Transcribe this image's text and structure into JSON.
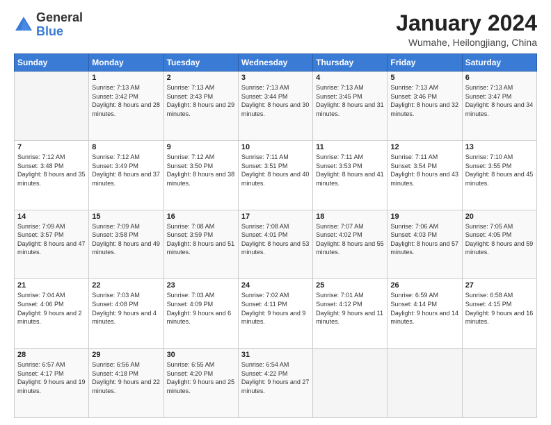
{
  "header": {
    "logo": {
      "general": "General",
      "blue": "Blue"
    },
    "title": "January 2024",
    "location": "Wumahe, Heilongjiang, China"
  },
  "weekdays": [
    "Sunday",
    "Monday",
    "Tuesday",
    "Wednesday",
    "Thursday",
    "Friday",
    "Saturday"
  ],
  "weeks": [
    [
      {
        "day": "",
        "sunrise": "",
        "sunset": "",
        "daylight": ""
      },
      {
        "day": "1",
        "sunrise": "Sunrise: 7:13 AM",
        "sunset": "Sunset: 3:42 PM",
        "daylight": "Daylight: 8 hours and 28 minutes."
      },
      {
        "day": "2",
        "sunrise": "Sunrise: 7:13 AM",
        "sunset": "Sunset: 3:43 PM",
        "daylight": "Daylight: 8 hours and 29 minutes."
      },
      {
        "day": "3",
        "sunrise": "Sunrise: 7:13 AM",
        "sunset": "Sunset: 3:44 PM",
        "daylight": "Daylight: 8 hours and 30 minutes."
      },
      {
        "day": "4",
        "sunrise": "Sunrise: 7:13 AM",
        "sunset": "Sunset: 3:45 PM",
        "daylight": "Daylight: 8 hours and 31 minutes."
      },
      {
        "day": "5",
        "sunrise": "Sunrise: 7:13 AM",
        "sunset": "Sunset: 3:46 PM",
        "daylight": "Daylight: 8 hours and 32 minutes."
      },
      {
        "day": "6",
        "sunrise": "Sunrise: 7:13 AM",
        "sunset": "Sunset: 3:47 PM",
        "daylight": "Daylight: 8 hours and 34 minutes."
      }
    ],
    [
      {
        "day": "7",
        "sunrise": "Sunrise: 7:12 AM",
        "sunset": "Sunset: 3:48 PM",
        "daylight": "Daylight: 8 hours and 35 minutes."
      },
      {
        "day": "8",
        "sunrise": "Sunrise: 7:12 AM",
        "sunset": "Sunset: 3:49 PM",
        "daylight": "Daylight: 8 hours and 37 minutes."
      },
      {
        "day": "9",
        "sunrise": "Sunrise: 7:12 AM",
        "sunset": "Sunset: 3:50 PM",
        "daylight": "Daylight: 8 hours and 38 minutes."
      },
      {
        "day": "10",
        "sunrise": "Sunrise: 7:11 AM",
        "sunset": "Sunset: 3:51 PM",
        "daylight": "Daylight: 8 hours and 40 minutes."
      },
      {
        "day": "11",
        "sunrise": "Sunrise: 7:11 AM",
        "sunset": "Sunset: 3:53 PM",
        "daylight": "Daylight: 8 hours and 41 minutes."
      },
      {
        "day": "12",
        "sunrise": "Sunrise: 7:11 AM",
        "sunset": "Sunset: 3:54 PM",
        "daylight": "Daylight: 8 hours and 43 minutes."
      },
      {
        "day": "13",
        "sunrise": "Sunrise: 7:10 AM",
        "sunset": "Sunset: 3:55 PM",
        "daylight": "Daylight: 8 hours and 45 minutes."
      }
    ],
    [
      {
        "day": "14",
        "sunrise": "Sunrise: 7:09 AM",
        "sunset": "Sunset: 3:57 PM",
        "daylight": "Daylight: 8 hours and 47 minutes."
      },
      {
        "day": "15",
        "sunrise": "Sunrise: 7:09 AM",
        "sunset": "Sunset: 3:58 PM",
        "daylight": "Daylight: 8 hours and 49 minutes."
      },
      {
        "day": "16",
        "sunrise": "Sunrise: 7:08 AM",
        "sunset": "Sunset: 3:59 PM",
        "daylight": "Daylight: 8 hours and 51 minutes."
      },
      {
        "day": "17",
        "sunrise": "Sunrise: 7:08 AM",
        "sunset": "Sunset: 4:01 PM",
        "daylight": "Daylight: 8 hours and 53 minutes."
      },
      {
        "day": "18",
        "sunrise": "Sunrise: 7:07 AM",
        "sunset": "Sunset: 4:02 PM",
        "daylight": "Daylight: 8 hours and 55 minutes."
      },
      {
        "day": "19",
        "sunrise": "Sunrise: 7:06 AM",
        "sunset": "Sunset: 4:03 PM",
        "daylight": "Daylight: 8 hours and 57 minutes."
      },
      {
        "day": "20",
        "sunrise": "Sunrise: 7:05 AM",
        "sunset": "Sunset: 4:05 PM",
        "daylight": "Daylight: 8 hours and 59 minutes."
      }
    ],
    [
      {
        "day": "21",
        "sunrise": "Sunrise: 7:04 AM",
        "sunset": "Sunset: 4:06 PM",
        "daylight": "Daylight: 9 hours and 2 minutes."
      },
      {
        "day": "22",
        "sunrise": "Sunrise: 7:03 AM",
        "sunset": "Sunset: 4:08 PM",
        "daylight": "Daylight: 9 hours and 4 minutes."
      },
      {
        "day": "23",
        "sunrise": "Sunrise: 7:03 AM",
        "sunset": "Sunset: 4:09 PM",
        "daylight": "Daylight: 9 hours and 6 minutes."
      },
      {
        "day": "24",
        "sunrise": "Sunrise: 7:02 AM",
        "sunset": "Sunset: 4:11 PM",
        "daylight": "Daylight: 9 hours and 9 minutes."
      },
      {
        "day": "25",
        "sunrise": "Sunrise: 7:01 AM",
        "sunset": "Sunset: 4:12 PM",
        "daylight": "Daylight: 9 hours and 11 minutes."
      },
      {
        "day": "26",
        "sunrise": "Sunrise: 6:59 AM",
        "sunset": "Sunset: 4:14 PM",
        "daylight": "Daylight: 9 hours and 14 minutes."
      },
      {
        "day": "27",
        "sunrise": "Sunrise: 6:58 AM",
        "sunset": "Sunset: 4:15 PM",
        "daylight": "Daylight: 9 hours and 16 minutes."
      }
    ],
    [
      {
        "day": "28",
        "sunrise": "Sunrise: 6:57 AM",
        "sunset": "Sunset: 4:17 PM",
        "daylight": "Daylight: 9 hours and 19 minutes."
      },
      {
        "day": "29",
        "sunrise": "Sunrise: 6:56 AM",
        "sunset": "Sunset: 4:18 PM",
        "daylight": "Daylight: 9 hours and 22 minutes."
      },
      {
        "day": "30",
        "sunrise": "Sunrise: 6:55 AM",
        "sunset": "Sunset: 4:20 PM",
        "daylight": "Daylight: 9 hours and 25 minutes."
      },
      {
        "day": "31",
        "sunrise": "Sunrise: 6:54 AM",
        "sunset": "Sunset: 4:22 PM",
        "daylight": "Daylight: 9 hours and 27 minutes."
      },
      {
        "day": "",
        "sunrise": "",
        "sunset": "",
        "daylight": ""
      },
      {
        "day": "",
        "sunrise": "",
        "sunset": "",
        "daylight": ""
      },
      {
        "day": "",
        "sunrise": "",
        "sunset": "",
        "daylight": ""
      }
    ]
  ]
}
